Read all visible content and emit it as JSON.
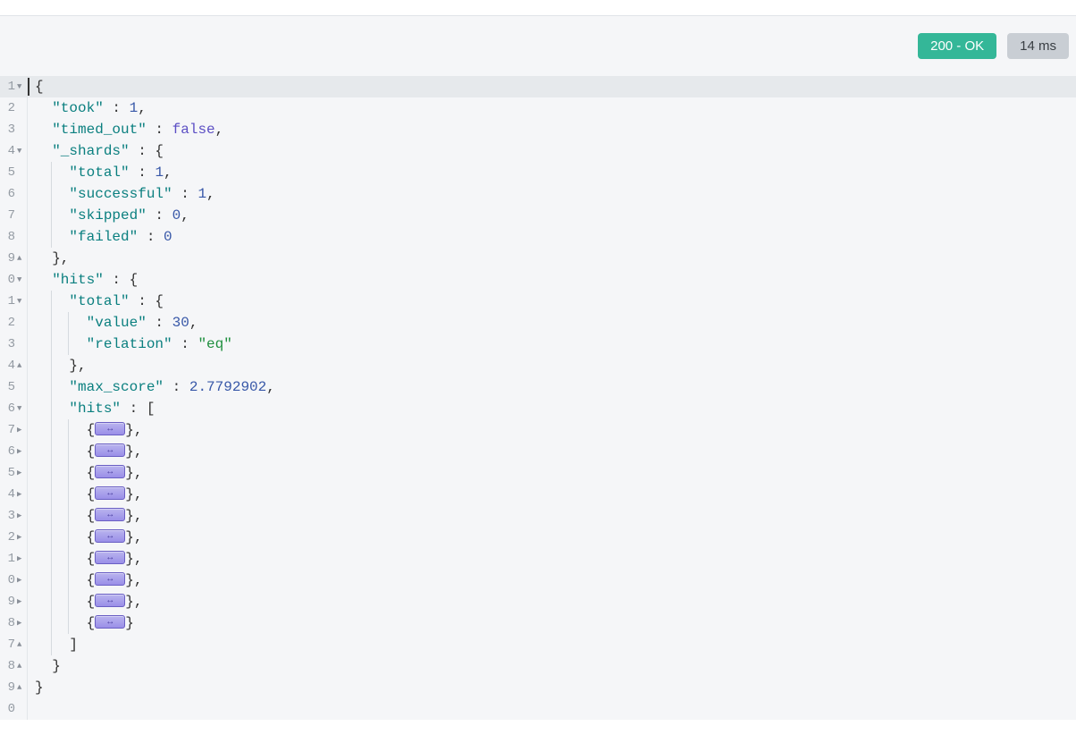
{
  "status": {
    "http_status": "200 - OK",
    "latency": "14 ms"
  },
  "gutter": {
    "numbers": [
      "1",
      "2",
      "3",
      "4",
      "5",
      "6",
      "7",
      "8",
      "9",
      "0",
      "1",
      "2",
      "3",
      "4",
      "5",
      "6",
      "7",
      "6",
      "5",
      "4",
      "3",
      "2",
      "1",
      "0",
      "9",
      "8",
      "7",
      "8",
      "9",
      "0"
    ],
    "fold_markers": {
      "0": "▼",
      "3": "▼",
      "8": "▲",
      "9": "▼",
      "10": "▼",
      "13": "▲",
      "15": "▼",
      "16": "▶",
      "17": "▶",
      "18": "▶",
      "19": "▶",
      "20": "▶",
      "21": "▶",
      "22": "▶",
      "23": "▶",
      "24": "▶",
      "25": "▶",
      "26": "▲",
      "27": "▲",
      "28": "▲"
    }
  },
  "json": {
    "took": 1,
    "timed_out": false,
    "shards": {
      "total": 1,
      "successful": 1,
      "skipped": 0,
      "failed": 0
    },
    "hits": {
      "total": {
        "value": 30,
        "relation": "eq"
      },
      "max_score": 2.7792902,
      "inner_hits_count": 10
    }
  },
  "text": {
    "l0": "{",
    "l1_key": "\"took\"",
    "l1_colon": " : ",
    "l1_val": "1",
    "l1_end": ",",
    "l2_key": "\"timed_out\"",
    "l2_val": "false",
    "l2_end": ",",
    "l3_key": "\"_shards\"",
    "l3_rest": " : {",
    "l4_key": "\"total\"",
    "l4_val": "1",
    "l4_end": ",",
    "l5_key": "\"successful\"",
    "l5_val": "1",
    "l5_end": ",",
    "l6_key": "\"skipped\"",
    "l6_val": "0",
    "l6_end": ",",
    "l7_key": "\"failed\"",
    "l7_val": "0",
    "l8": "},",
    "l9_key": "\"hits\"",
    "l9_rest": " : {",
    "l10_key": "\"total\"",
    "l10_rest": " : {",
    "l11_key": "\"value\"",
    "l11_val": "30",
    "l11_end": ",",
    "l12_key": "\"relation\"",
    "l12_val": "\"eq\"",
    "l13": "},",
    "l14_key": "\"max_score\"",
    "l14_val": "2.7792902",
    "l14_end": ",",
    "l15_key": "\"hits\"",
    "l15_rest": " : [",
    "fold_open": "{",
    "fold_close_comma": "},",
    "fold_close": "}",
    "l26": "]",
    "l27": "}",
    "l28": "}"
  }
}
